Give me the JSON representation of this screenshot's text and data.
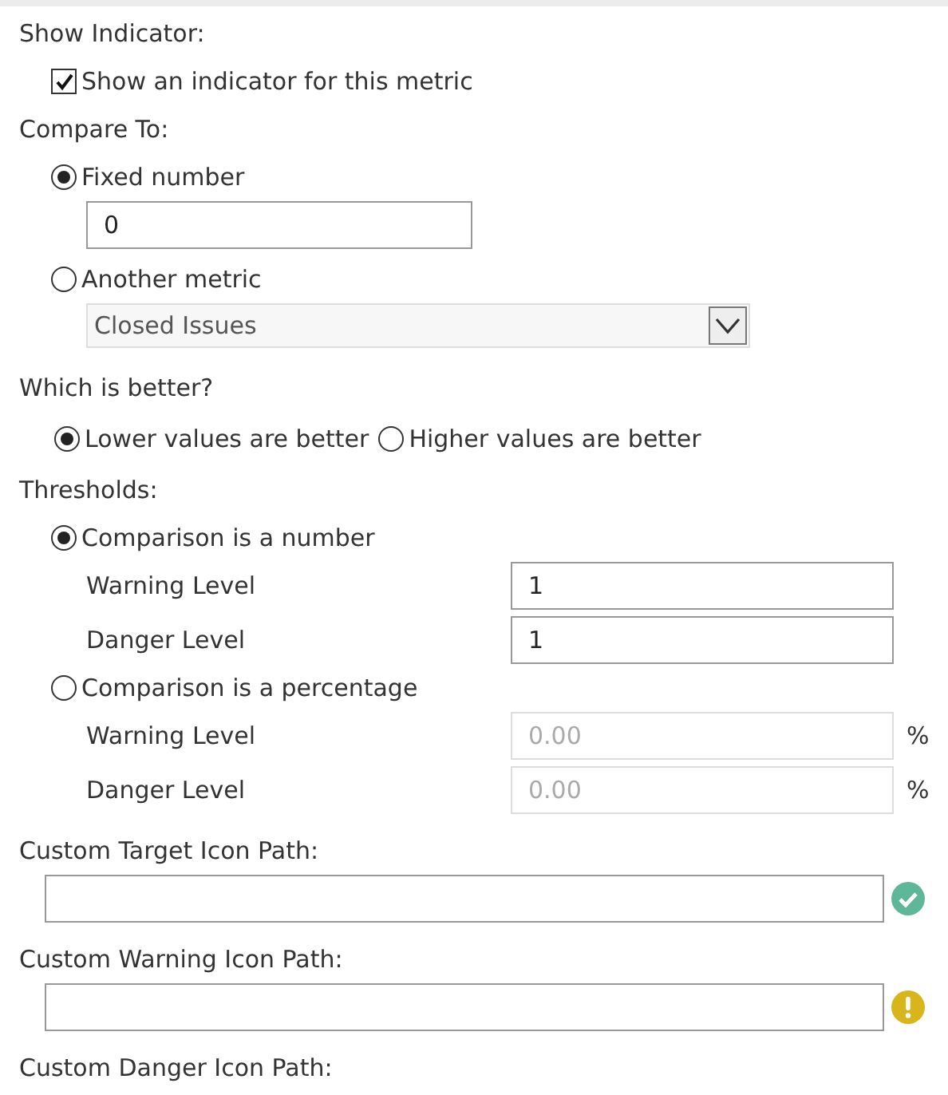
{
  "show_indicator": {
    "label": "Show Indicator:",
    "checkbox": {
      "label": "Show an indicator for this metric",
      "checked": true
    }
  },
  "compare_to": {
    "label": "Compare To:",
    "options": [
      {
        "label": "Fixed number",
        "selected": true,
        "kind": "input",
        "value": "0"
      },
      {
        "label": "Another metric",
        "selected": false,
        "kind": "dropdown",
        "value": "Closed Issues"
      }
    ]
  },
  "which_is_better": {
    "label": "Which is better?",
    "options": [
      {
        "label": "Lower values are better",
        "selected": true
      },
      {
        "label": "Higher values are better",
        "selected": false
      }
    ]
  },
  "thresholds": {
    "label": "Thresholds:",
    "modes": [
      {
        "label": "Comparison is a number",
        "selected": true,
        "fields": [
          {
            "label": "Warning Level",
            "value": "1"
          },
          {
            "label": "Danger Level",
            "value": "1"
          }
        ]
      },
      {
        "label": "Comparison is a percentage",
        "selected": false,
        "unit": "%",
        "fields": [
          {
            "label": "Warning Level",
            "value": "0.00"
          },
          {
            "label": "Danger Level",
            "value": "0.00"
          }
        ]
      }
    ]
  },
  "icon_paths": [
    {
      "label": "Custom Target Icon Path:",
      "kind": "check"
    },
    {
      "label": "Custom Warning Icon Path:",
      "kind": "warning"
    },
    {
      "label": "Custom Danger Icon Path:"
    }
  ]
}
